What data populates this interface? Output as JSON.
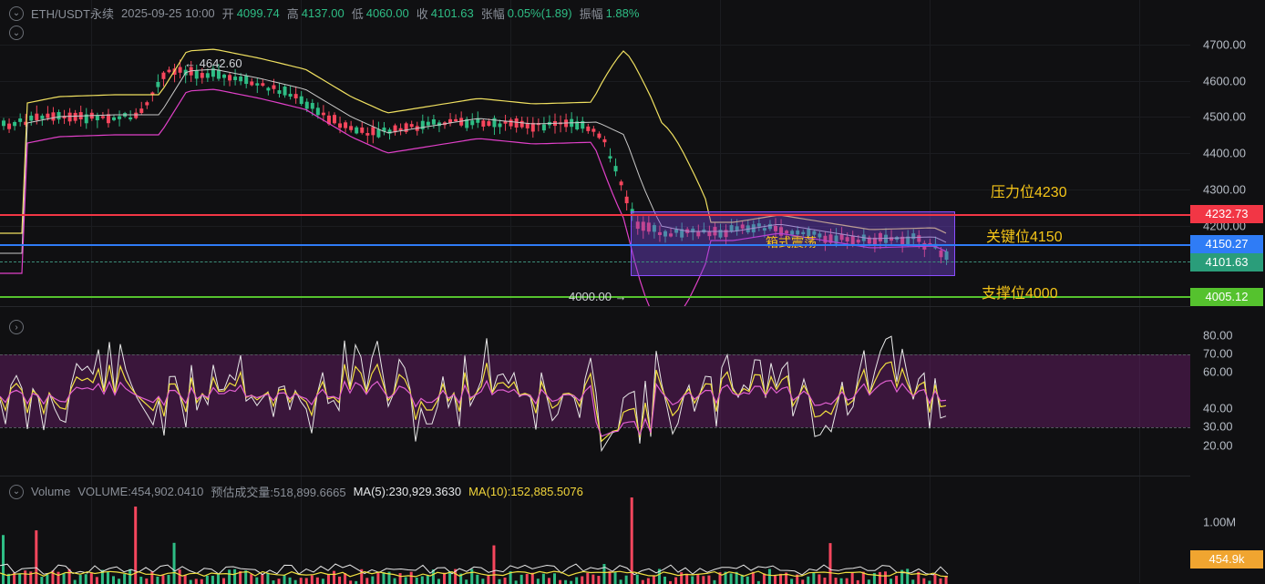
{
  "legend": {
    "symbol": "ETH/USDT永续",
    "datetime": "2025-09-25 10:00",
    "open_label": "开",
    "open": "4099.74",
    "high_label": "高",
    "high": "4137.00",
    "low_label": "低",
    "low": "4060.00",
    "close_label": "收",
    "close": "4101.63",
    "change_label": "张幅",
    "change": "0.05%(1.89)",
    "amplitude_label": "振幅",
    "amplitude": "1.88%"
  },
  "price_axis": {
    "ticks": [
      "4700.00",
      "4600.00",
      "4500.00",
      "4400.00",
      "4300.00",
      "4200.00"
    ],
    "tags": {
      "resistance": "4232.73",
      "key": "4150.27",
      "last": "4101.63",
      "support": "4005.12"
    }
  },
  "annotations": {
    "resistance_label": "压力位4230",
    "key_label": "关键位4150",
    "support_label": "支撑位4000",
    "box_label": "箱式震荡",
    "high_marker": "← 4642.60",
    "low_marker": "4000.00 →"
  },
  "rsi_axis": {
    "ticks": [
      "80.00",
      "70.00",
      "60.00",
      "40.00",
      "30.00",
      "20.00"
    ]
  },
  "volume": {
    "title": "Volume",
    "value_text": "VOLUME:454,902.0410",
    "estimate_text": "预估成交量:518,899.6665",
    "ma5_text": "MA(5):230,929.3630",
    "ma10_text": "MA(10):152,885.5076",
    "axis_tick": "1.00M",
    "tag": "454.9k"
  },
  "colors": {
    "up": "#2ebd85",
    "down": "#f6465d",
    "resistance_line": "#f23645",
    "key_line": "#2f7cf6",
    "support_line": "#55c22e",
    "last_tag": "#2ebd85",
    "volume_tag": "#f0a530",
    "annotation": "#f5c518"
  },
  "icons": [
    "chevron-down-icon",
    "chevron-down-icon",
    "chevron-right-icon",
    "chevron-down-icon"
  ]
}
